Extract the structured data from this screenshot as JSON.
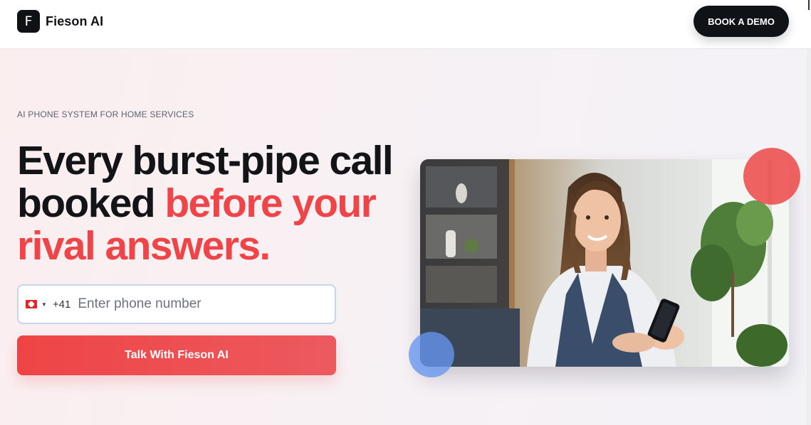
{
  "header": {
    "logo_letter": "F",
    "brand_name": "Fieson AI",
    "cta_label": "BOOK A DEMO"
  },
  "hero": {
    "eyebrow": "AI PHONE SYSTEM FOR HOME SERVICES",
    "headline_part1": "Every burst-pipe call booked ",
    "headline_accent": "before your rival answers.",
    "phone": {
      "country_flag": "swiss-flag-icon",
      "dial_code": "+41",
      "placeholder": "Enter phone number",
      "value": ""
    },
    "submit_label": "Talk With Fieson AI"
  },
  "image": {
    "alt": "Smiling woman in apron holding a smartphone"
  },
  "colors": {
    "accent": "#ef4448",
    "dark": "#0f1217",
    "input_border": "#c5d5ef",
    "blob_red": "#ec4848",
    "blob_blue": "#6796f0"
  }
}
